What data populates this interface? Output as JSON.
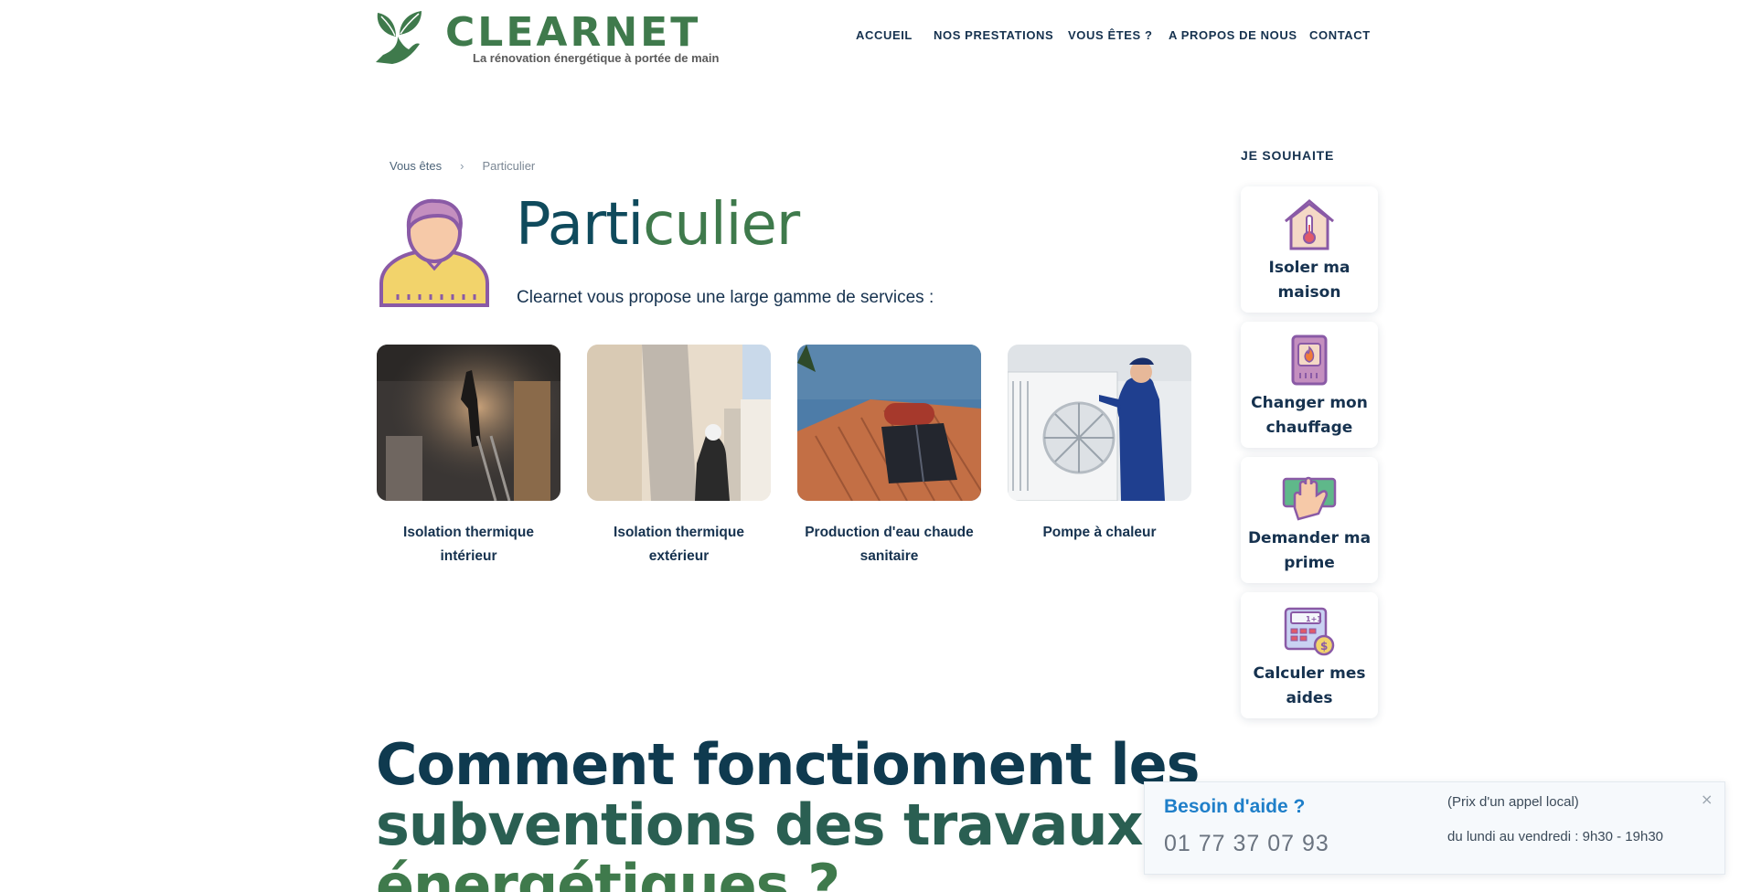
{
  "header": {
    "logo_name": "CLEARNET",
    "logo_tagline": "La rénovation énergétique à portée de main",
    "nav": [
      "ACCUEIL",
      "NOS PRESTATIONS",
      "VOUS ÊTES ?",
      "A PROPOS DE NOUS",
      "CONTACT"
    ]
  },
  "breadcrumb": {
    "parent": "Vous êtes",
    "separator": "›",
    "current": "Particulier"
  },
  "page": {
    "title_part1": "Parti",
    "title_part2": "culier",
    "intro": "Clearnet vous propose une large gamme de services :"
  },
  "services": [
    {
      "label": "Isolation thermique intérieur"
    },
    {
      "label": "Isolation thermique extérieur"
    },
    {
      "label": "Production d'eau chaude sanitaire"
    },
    {
      "label": "Pompe à chaleur"
    }
  ],
  "sidebar": {
    "title": "JE SOUHAITE",
    "items": [
      {
        "label": "Isoler ma maison",
        "icon": "house-thermometer-icon"
      },
      {
        "label": "Changer mon chauffage",
        "icon": "boiler-flame-icon"
      },
      {
        "label": "Demander ma prime",
        "icon": "hand-money-icon"
      },
      {
        "label": "Calculer mes aides",
        "icon": "calculator-icon"
      }
    ]
  },
  "section_heading": {
    "line1": "Comment fonctionnent les",
    "line2": "subventions des travaux",
    "line3": "énergétiques ?"
  },
  "help_widget": {
    "title": "Besoin d'aide ?",
    "phone": "01 77 37 07 93",
    "price_note": "(Prix d'un appel local)",
    "hours": "du lundi au vendredi : 9h30 - 19h30",
    "close": "×"
  },
  "colors": {
    "brand_green": "#3f7a4c",
    "navy": "#16324f",
    "teal_title": "#0f4a5c",
    "help_blue": "#1f7fc9",
    "icon_purple": "#8a5aa6"
  }
}
